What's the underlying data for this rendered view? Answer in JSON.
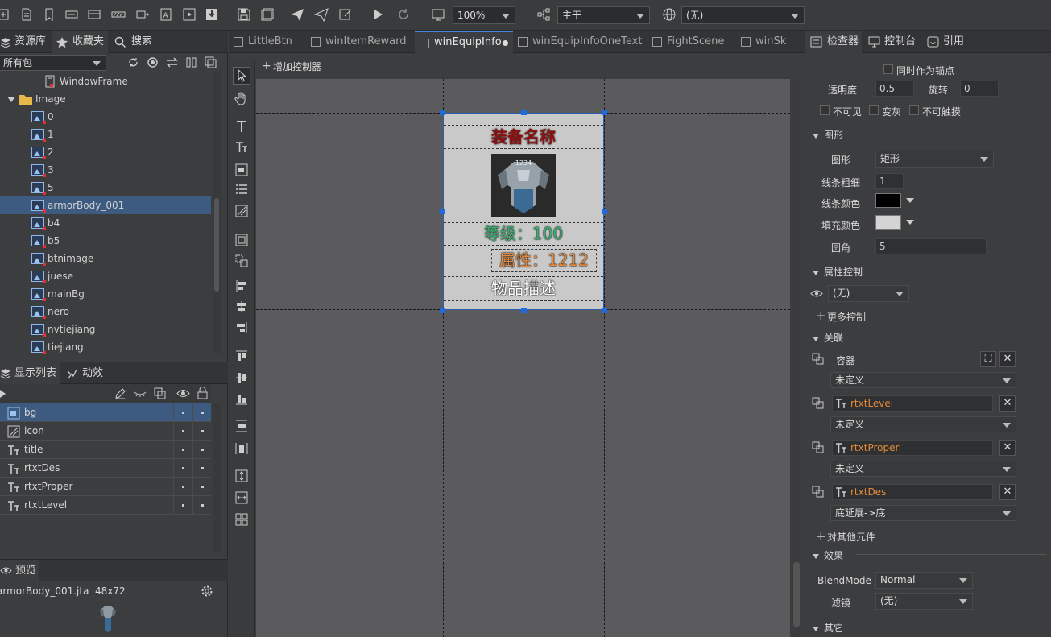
{
  "toolbar": {
    "zoom": "100%",
    "branch": "主干",
    "language": "(无)"
  },
  "left": {
    "tabs": [
      "资源库",
      "收藏夹",
      "搜索"
    ],
    "package_filter": "所有包",
    "tree": [
      {
        "label": "WindowFrame",
        "type": "frame"
      },
      {
        "label": "Image",
        "type": "folder"
      },
      {
        "label": "0",
        "type": "image"
      },
      {
        "label": "1",
        "type": "image"
      },
      {
        "label": "2",
        "type": "image"
      },
      {
        "label": "3",
        "type": "image"
      },
      {
        "label": "5",
        "type": "image"
      },
      {
        "label": "armorBody_001",
        "type": "movieclip",
        "selected": true
      },
      {
        "label": "b4",
        "type": "image"
      },
      {
        "label": "b5",
        "type": "image"
      },
      {
        "label": "btnimage",
        "type": "image"
      },
      {
        "label": "juese",
        "type": "image"
      },
      {
        "label": "mainBg",
        "type": "image"
      },
      {
        "label": "nero",
        "type": "image"
      },
      {
        "label": "nvtiejiang",
        "type": "image"
      },
      {
        "label": "tiejiang",
        "type": "image"
      }
    ],
    "display_tabs": [
      "显示列表",
      "动效"
    ],
    "display_list": [
      {
        "label": "bg",
        "icon": "graph-icon",
        "selected": true
      },
      {
        "label": "icon",
        "icon": "loader-icon"
      },
      {
        "label": "title",
        "icon": "text-icon"
      },
      {
        "label": "rtxtDes",
        "icon": "richtext-icon"
      },
      {
        "label": "rtxtProper",
        "icon": "richtext-icon"
      },
      {
        "label": "rtxtLevel",
        "icon": "richtext-icon"
      }
    ],
    "preview_title": "预览",
    "preview_file": "armorBody_001.jta",
    "preview_size": "48x72"
  },
  "center": {
    "doc_tabs": [
      "LittleBtn",
      "winItemReward",
      "winEquipInfo",
      "winEquipInfoOneText",
      "FightScene",
      "winSk"
    ],
    "active_tab": "winEquipInfo",
    "add_controller": "增加控制器",
    "card": {
      "title": "装备名称",
      "icon_caption": "1234",
      "level": "等级：100",
      "property": "属性：1212",
      "description": "物品描述"
    }
  },
  "inspector": {
    "tabs": [
      "检查器",
      "控制台",
      "引用"
    ],
    "anchor_label": "同时作为锚点",
    "alpha_label": "透明度",
    "alpha_value": "0.5",
    "rotation_label": "旋转",
    "rotation_value": "0",
    "invisible_label": "不可见",
    "gray_label": "变灰",
    "untouchable_label": "不可触摸",
    "shape_section": "图形",
    "shape_label": "图形",
    "shape_value": "矩形",
    "line_width_label": "线条粗细",
    "line_width_value": "1",
    "line_color_label": "线条颜色",
    "line_color": "#000000",
    "fill_color_label": "填充颜色",
    "fill_color": "#d4d4d4",
    "corner_label": "圆角",
    "corner_value": "5",
    "gear_section": "属性控制",
    "gear_value": "(无)",
    "more_control": "更多控制",
    "relation_section": "关联",
    "relations": [
      {
        "target": "容器",
        "mode": "未定义",
        "orange": false
      },
      {
        "target": "rtxtLevel",
        "mode": "未定义",
        "orange": true
      },
      {
        "target": "rtxtProper",
        "mode": "未定义",
        "orange": true
      },
      {
        "target": "rtxtDes",
        "mode": "底延展->底",
        "orange": true
      }
    ],
    "other_relation": "对其他元件",
    "effect_section": "效果",
    "blend_label": "BlendMode",
    "blend_value": "Normal",
    "filter_label": "滤镜",
    "filter_value": "(无)",
    "other_section": "其它"
  },
  "colors": {
    "accent": "#3d5a80",
    "card_title": "#8b1010",
    "card_level": "#3ab071",
    "card_property": "#e48a3a",
    "selection": "#1e6ae0"
  }
}
